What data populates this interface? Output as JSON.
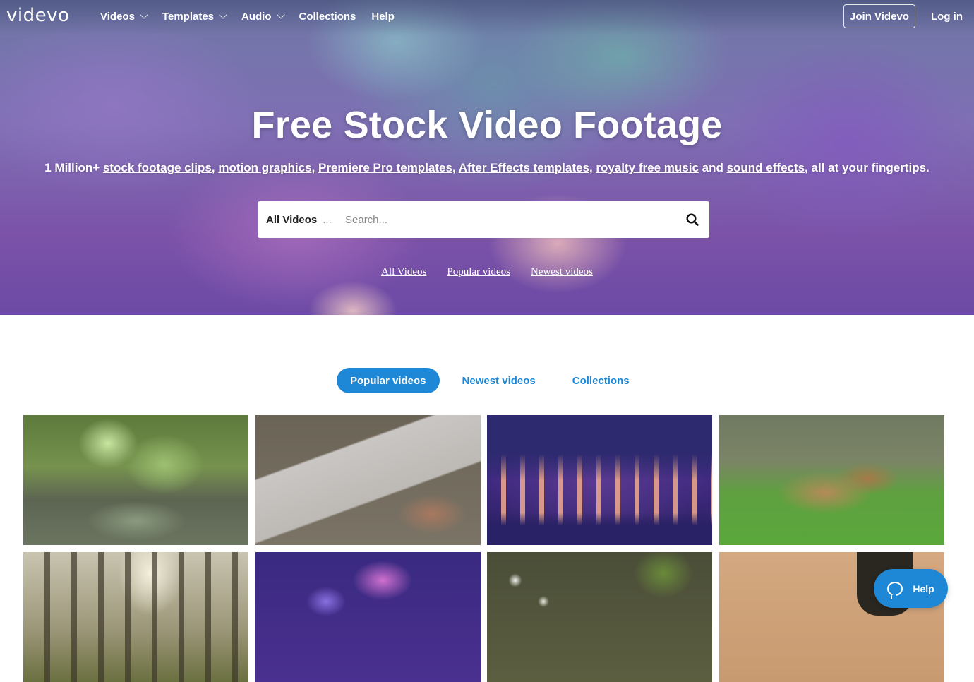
{
  "header": {
    "logo": "videvo",
    "nav": [
      {
        "label": "Videos",
        "dropdown": true
      },
      {
        "label": "Templates",
        "dropdown": true
      },
      {
        "label": "Audio",
        "dropdown": true
      },
      {
        "label": "Collections",
        "dropdown": false
      },
      {
        "label": "Help",
        "dropdown": false
      }
    ],
    "join_label": "Join Videvo",
    "login_label": "Log in"
  },
  "hero": {
    "title": "Free Stock Video Footage",
    "subtitle_prefix": "1 Million+ ",
    "subtitle_links": [
      "stock footage clips",
      "motion graphics",
      "Premiere Pro templates",
      "After Effects templates",
      "royalty free music",
      "sound effects"
    ],
    "subtitle_and": " and ",
    "subtitle_suffix": ", all at your fingertips.",
    "search": {
      "category": "All Videos",
      "category_more": "...",
      "placeholder": "Search..."
    },
    "quick_links": [
      "All Videos",
      "Popular videos",
      "Newest videos"
    ]
  },
  "tabs": [
    {
      "label": "Popular videos",
      "active": true
    },
    {
      "label": "Newest videos",
      "active": false
    },
    {
      "label": "Collections",
      "active": false
    }
  ],
  "help_widget": {
    "label": "Help"
  },
  "colors": {
    "accent": "#1e88d6"
  }
}
